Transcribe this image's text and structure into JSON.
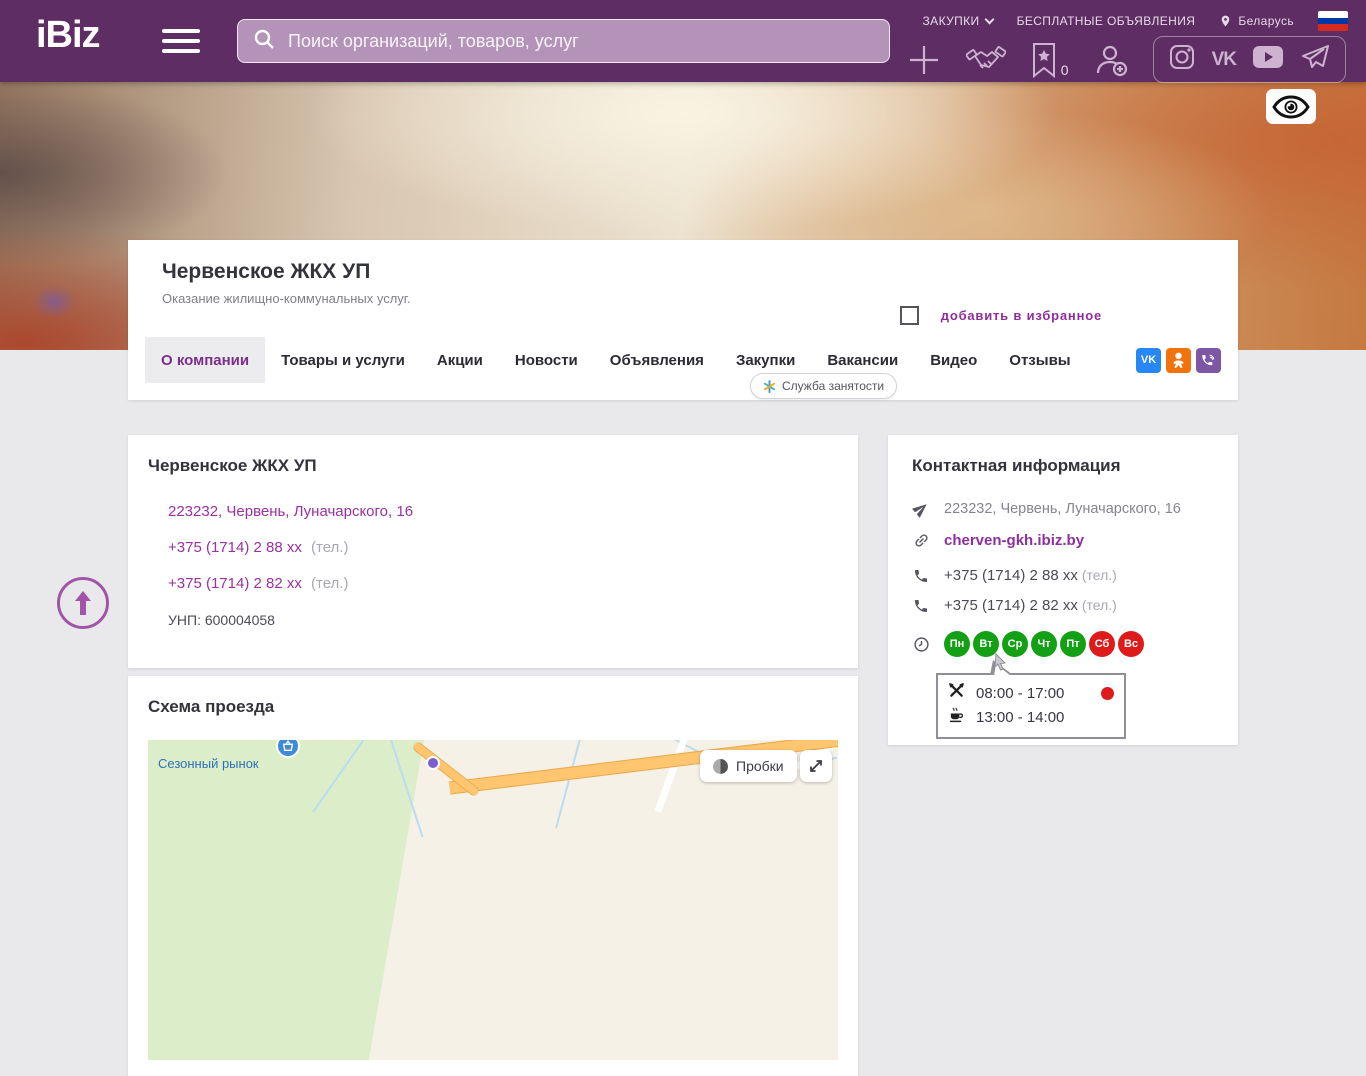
{
  "header": {
    "logo": "iBiz",
    "search_placeholder": "Поиск организаций, товаров, услуг",
    "nav": {
      "zakupki": "ЗАКУПКИ",
      "free_ads": "БЕСПЛАТНЫЕ ОБЪЯВЛЕНИЯ",
      "country": "Беларусь"
    },
    "favorites_count": "0"
  },
  "company": {
    "name": "Червенское ЖКХ УП",
    "description": "Оказание жилищно-коммунальных услуг.",
    "favorite_label": "добавить в избранное"
  },
  "tabs": [
    {
      "label": "О компании",
      "active": "true"
    },
    {
      "label": "Товары и услуги",
      "active": "false"
    },
    {
      "label": "Акции",
      "active": "false"
    },
    {
      "label": "Новости",
      "active": "false"
    },
    {
      "label": "Объявления",
      "active": "false"
    },
    {
      "label": "Закупки",
      "active": "false"
    },
    {
      "label": "Вакансии",
      "active": "false"
    },
    {
      "label": "Видео",
      "active": "false"
    },
    {
      "label": "Отзывы",
      "active": "false"
    }
  ],
  "employment_badge": "Служба занятости",
  "about": {
    "title": "Червенское ЖКХ УП",
    "address": "223232, Червень, Луначарского, 16",
    "phones": [
      {
        "number": "+375 (1714) 2 88 хх",
        "note": "(тел.)"
      },
      {
        "number": "+375 (1714) 2 82 хх",
        "note": "(тел.)"
      }
    ],
    "unp": "УНП: 600004058"
  },
  "map_section": {
    "title": "Схема проезда",
    "map_label": "Сезонный рынок",
    "traffic_button": "Пробки"
  },
  "contact": {
    "title": "Контактная информация",
    "address": "223232, Червень, Луначарского, 16",
    "website": "cherven-gkh.ibiz.by",
    "phones": [
      {
        "number": "+375 (1714) 2 88 хх",
        "note": "(тел.)"
      },
      {
        "number": "+375 (1714) 2 82 хх",
        "note": "(тел.)"
      }
    ],
    "days": [
      {
        "label": "Пн",
        "type": "work"
      },
      {
        "label": "Вт",
        "type": "work"
      },
      {
        "label": "Ср",
        "type": "work"
      },
      {
        "label": "Чт",
        "type": "work"
      },
      {
        "label": "Пт",
        "type": "work"
      },
      {
        "label": "Сб",
        "type": "off"
      },
      {
        "label": "Вс",
        "type": "off"
      }
    ],
    "hours": {
      "work": "08:00 - 17:00",
      "break": "13:00 - 14:00"
    }
  },
  "colors": {
    "header_bg": "#5d2d63",
    "accent": "#9b30a1",
    "day_work": "#14a014",
    "day_off": "#de1b1b",
    "vk": "#2787f5",
    "ok": "#f2720c",
    "viber": "#7d57a4"
  }
}
